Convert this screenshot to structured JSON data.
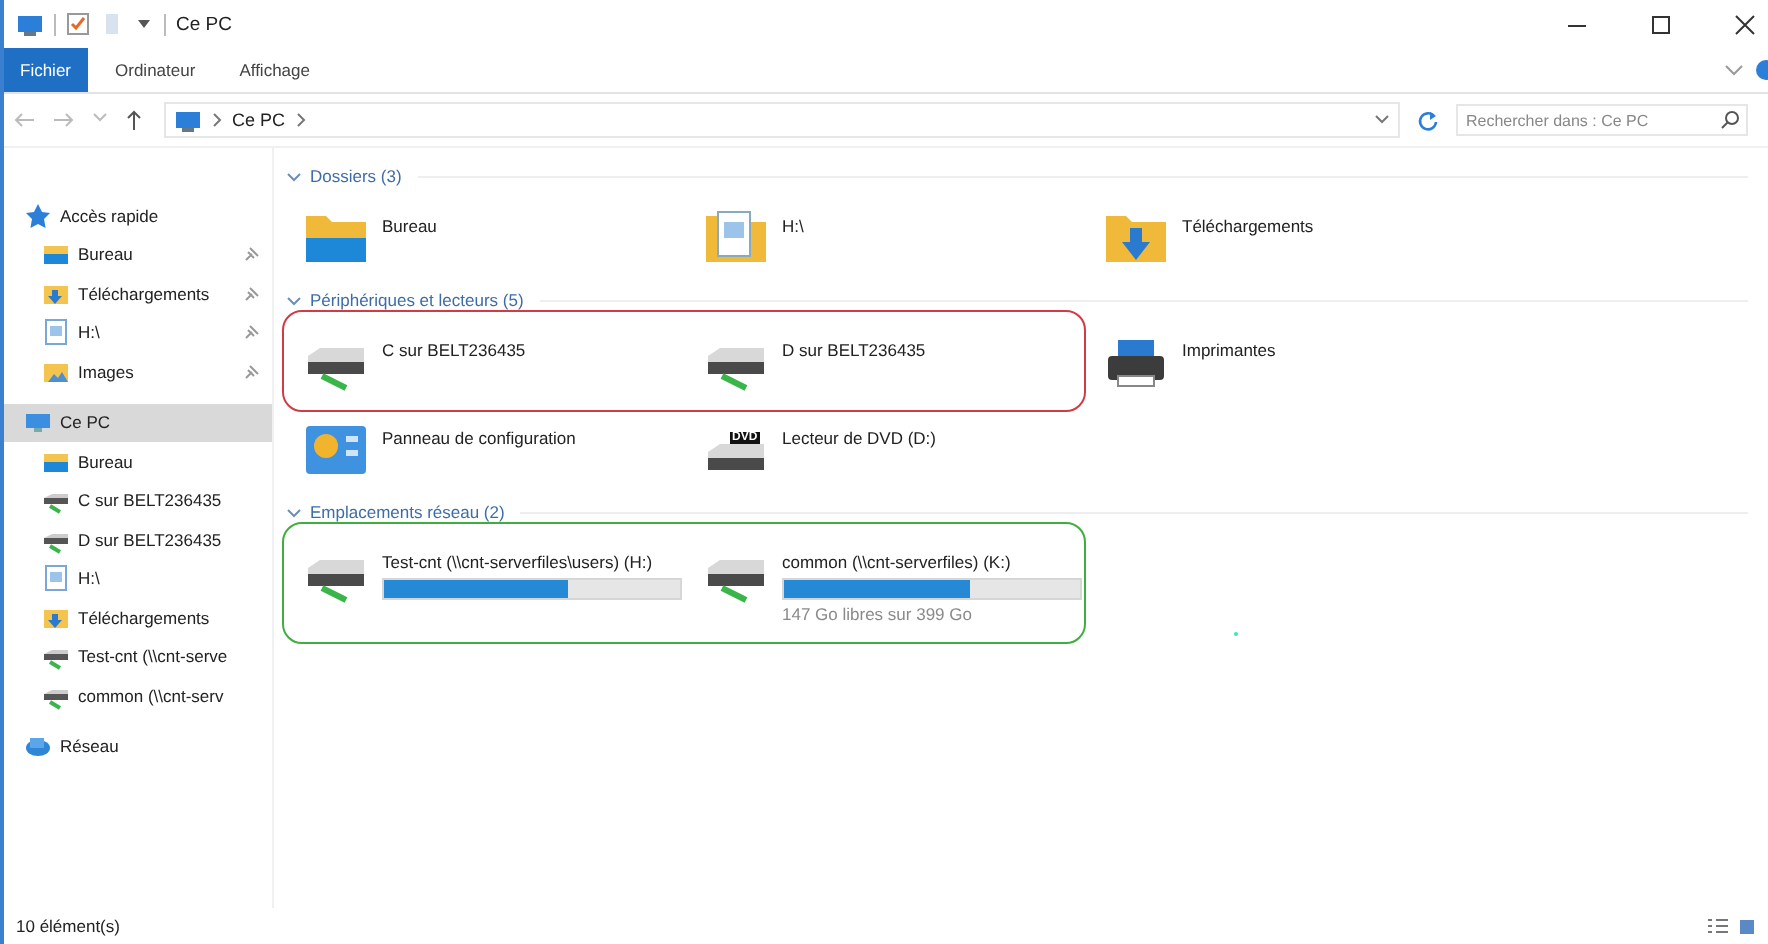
{
  "window": {
    "title": "Ce PC"
  },
  "ribbon_tabs": [
    {
      "label": "Fichier",
      "selected": true
    },
    {
      "label": "Ordinateur",
      "selected": false
    },
    {
      "label": "Affichage",
      "selected": false
    }
  ],
  "address_bar": {
    "path": [
      "Ce PC"
    ]
  },
  "search": {
    "placeholder": "Rechercher dans : Ce PC"
  },
  "sidebar": {
    "items": [
      {
        "label": "Accès rapide",
        "kind": "star",
        "selected": false,
        "children": [
          {
            "label": "Bureau",
            "kind": "desktop",
            "selected": false,
            "pinned": true
          },
          {
            "label": "Téléchargements",
            "kind": "download",
            "selected": false,
            "pinned": true
          },
          {
            "label": "H:\\",
            "kind": "doc",
            "selected": false,
            "pinned": true
          },
          {
            "label": "Images",
            "kind": "pictures",
            "selected": false,
            "pinned": true
          }
        ]
      },
      {
        "label": "Ce PC",
        "kind": "pc",
        "selected": true,
        "children": [
          {
            "label": "Bureau",
            "kind": "desktop",
            "selected": false,
            "pinned": false
          },
          {
            "label": "C sur BELT236435",
            "kind": "drive",
            "selected": false,
            "pinned": false
          },
          {
            "label": "D sur BELT236435",
            "kind": "drive",
            "selected": false,
            "pinned": false
          },
          {
            "label": "H:\\",
            "kind": "doc",
            "selected": false,
            "pinned": false
          },
          {
            "label": "Téléchargements",
            "kind": "download",
            "selected": false,
            "pinned": false
          },
          {
            "label": "Test-cnt (\\\\cnt-serve",
            "kind": "drive",
            "selected": false,
            "pinned": false
          },
          {
            "label": "common (\\\\cnt-serv",
            "kind": "drive",
            "selected": false,
            "pinned": false
          }
        ]
      },
      {
        "label": "Réseau",
        "kind": "network",
        "selected": false
      }
    ]
  },
  "sections": [
    {
      "title": "Dossiers (3)",
      "rows": [
        {
          "groups": [
            {
              "items": [
                {
                  "kind": "desktop",
                  "label": "Bureau"
                },
                {
                  "kind": "doc",
                  "label": "H:\\"
                },
                {
                  "kind": "download",
                  "label": "Téléchargements"
                }
              ]
            }
          ]
        }
      ]
    },
    {
      "title": "Périphériques et lecteurs (5)",
      "rows": [
        {
          "groups": [
            {
              "color": "#d23a46",
              "items": [
                {
                  "kind": "drive",
                  "label": "C sur BELT236435"
                },
                {
                  "kind": "drive",
                  "label": "D sur BELT236435"
                }
              ]
            },
            {
              "items": [
                {
                  "kind": "printer",
                  "label": "Imprimantes"
                }
              ]
            }
          ]
        },
        {
          "groups": [
            {
              "items": [
                {
                  "kind": "control-panel",
                  "label": "Panneau de configuration"
                },
                {
                  "kind": "dvd",
                  "label": "Lecteur de DVD (D:)",
                  "badge": "DVD"
                }
              ]
            }
          ]
        }
      ]
    },
    {
      "title": "Emplacements réseau (2)",
      "rows": [
        {
          "groups": [
            {
              "color": "#3fae3f",
              "items": [
                {
                  "kind": "drive",
                  "label": "Test-cnt (\\\\cnt-serverfiles\\users) (H:)",
                  "level": 0.62
                },
                {
                  "kind": "drive",
                  "label": "common (\\\\cnt-serverfiles) (K:)",
                  "level": 0.63,
                  "detail": "147 Go libres sur 399 Go"
                }
              ]
            }
          ]
        }
      ]
    }
  ],
  "status_bar": {
    "text": "10 élément(s)"
  }
}
